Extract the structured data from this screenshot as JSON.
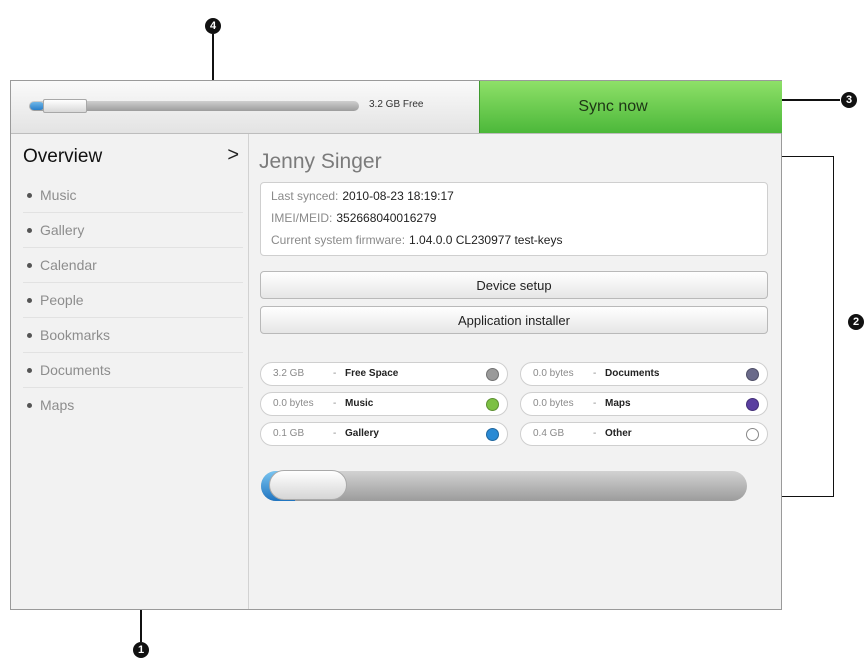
{
  "topbar": {
    "storage_free_label": "3.2  GB Free",
    "storage_used_fraction": 0.02,
    "sync_label": "Sync now"
  },
  "sidebar": {
    "overview_label": "Overview",
    "overview_chevron": ">",
    "items": [
      {
        "label": "Music"
      },
      {
        "label": "Gallery"
      },
      {
        "label": "Calendar"
      },
      {
        "label": "People"
      },
      {
        "label": "Bookmarks"
      },
      {
        "label": "Documents"
      },
      {
        "label": "Maps"
      }
    ]
  },
  "device": {
    "name": "Jenny Singer",
    "last_synced_label": "Last synced:",
    "last_synced_value": "2010-08-23 18:19:17",
    "imei_label": "IMEI/MEID:",
    "imei_value": "352668040016279",
    "firmware_label": "Current system firmware:",
    "firmware_value": "1.04.0.0 CL230977 test-keys"
  },
  "actions": {
    "device_setup": "Device setup",
    "app_installer": "Application installer"
  },
  "storage_legend": [
    {
      "size": "3.2  GB",
      "name": "Free Space",
      "color": "#9a9a9a",
      "ring": false
    },
    {
      "size": "0.0  bytes",
      "name": "Documents",
      "color": "#6a6a8a",
      "ring": false
    },
    {
      "size": "0.0 bytes",
      "name": "Music",
      "color": "#7cc043",
      "ring": false
    },
    {
      "size": "0.0  bytes",
      "name": "Maps",
      "color": "#5a3fa0",
      "ring": false
    },
    {
      "size": "0.1  GB",
      "name": "Gallery",
      "color": "#2a8ad4",
      "ring": false
    },
    {
      "size": "0.4  GB",
      "name": "Other",
      "color": "#ffffff",
      "ring": true
    }
  ],
  "storage_bar": {
    "used_fraction": 0.07
  },
  "callouts": {
    "c1": "1",
    "c2": "2",
    "c3": "3",
    "c4": "4"
  },
  "colors": {
    "sync_green": "#5cc444",
    "accent_blue": "#2a7fc9"
  }
}
